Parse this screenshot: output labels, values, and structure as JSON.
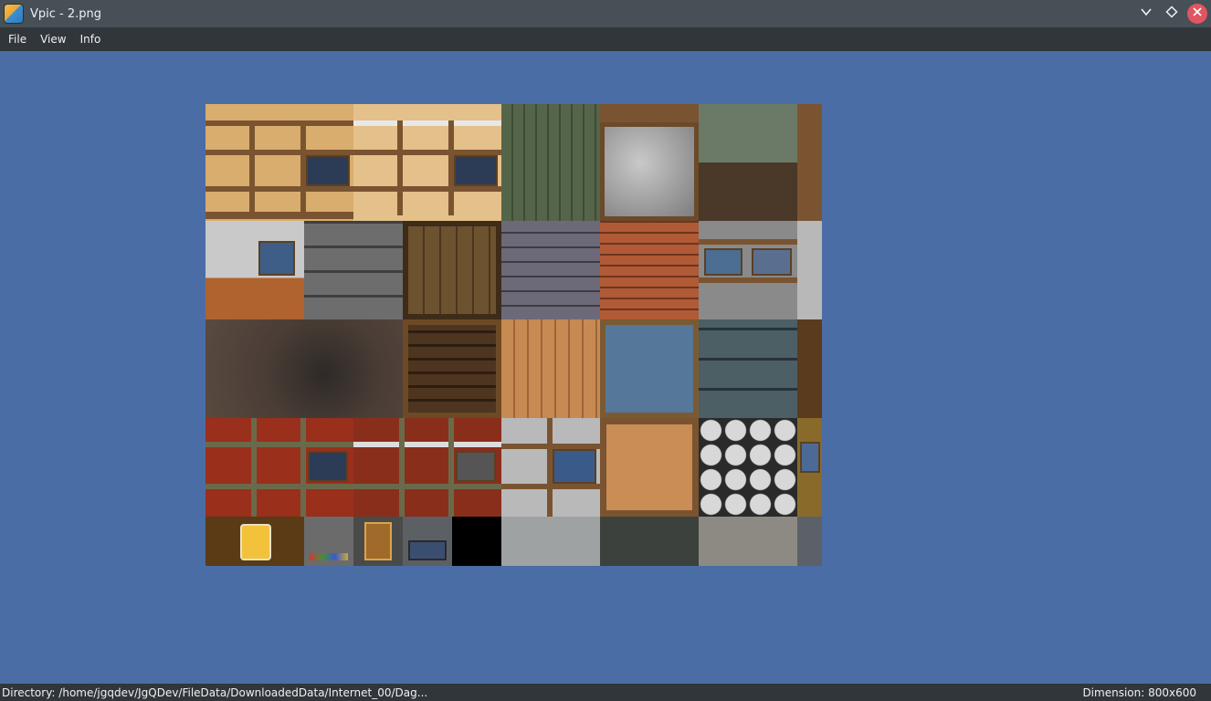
{
  "window": {
    "title": "Vpic - 2.png",
    "controls": {
      "minimize_icon": "chevron-down-icon",
      "maximize_icon": "diamond-icon",
      "close_icon": "close-icon"
    }
  },
  "menu": {
    "items": [
      {
        "label": "File"
      },
      {
        "label": "View"
      },
      {
        "label": "Info"
      }
    ]
  },
  "viewer": {
    "background_color": "#4a6da6",
    "image_description_icon": "texture-atlas-image"
  },
  "status": {
    "directory": "Directory: /home/jgqdev/JgQDev/FileData/DownloadedData/Internet_00/Dag...",
    "dimension": "Dimension: 800x600"
  }
}
